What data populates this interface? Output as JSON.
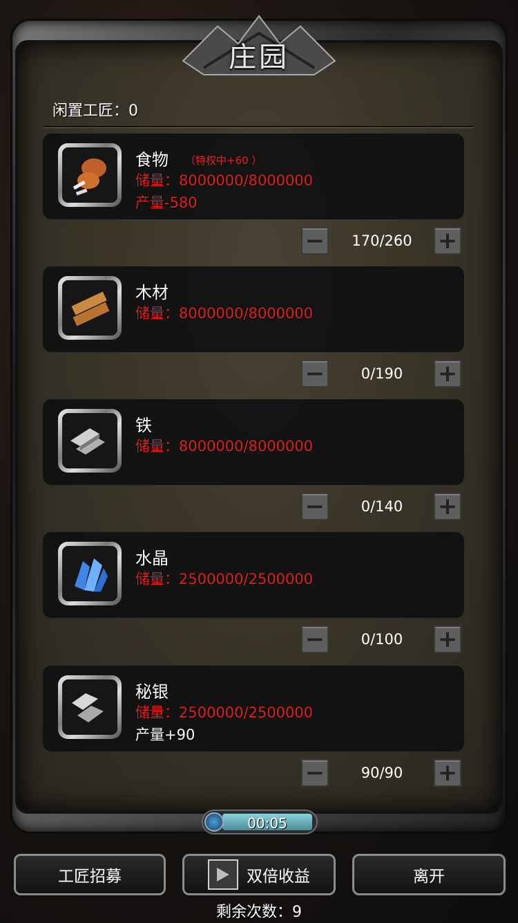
{
  "title": "庄园",
  "idle_label": "闲置工匠：0",
  "colors": {
    "storage_red": "#e11f1f",
    "frame_gray": "#7a7a7a",
    "timer_teal": "#8bd0dc"
  },
  "resources": [
    {
      "name": "食物",
      "privilege": "（特权中+60 ）",
      "storage": "储量：8000000/8000000",
      "production": "产量-580",
      "production_color": "#e11f1f",
      "workers": "170/260",
      "icon": "meat-icon"
    },
    {
      "name": "木材",
      "privilege": "",
      "storage": "储量：8000000/8000000",
      "production": "",
      "workers": "0/190",
      "icon": "wood-icon"
    },
    {
      "name": "铁",
      "privilege": "",
      "storage": "储量：8000000/8000000",
      "production": "",
      "workers": "0/140",
      "icon": "iron-icon"
    },
    {
      "name": "水晶",
      "privilege": "",
      "storage": "储量：2500000/2500000",
      "production": "",
      "workers": "0/100",
      "icon": "crystal-icon"
    },
    {
      "name": "秘银",
      "privilege": "",
      "storage": "储量：2500000/2500000",
      "production": "产量+90",
      "production_color": "#ffffff",
      "workers": "90/90",
      "icon": "mithril-icon"
    }
  ],
  "timer": "00:05",
  "buttons": {
    "recruit": "工匠招募",
    "double": "双倍收益",
    "leave": "离开"
  },
  "remaining": "剩余次数：9"
}
